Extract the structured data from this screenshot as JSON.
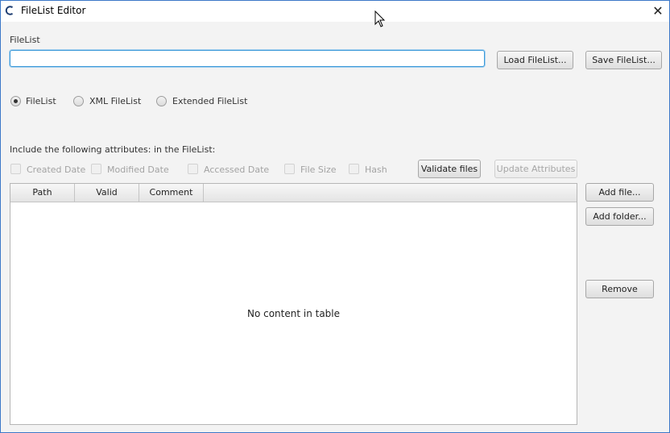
{
  "window": {
    "title": "FileList Editor"
  },
  "filelist": {
    "label": "FileList",
    "value": "",
    "load_button": "Load FileList...",
    "save_button": "Save FileList..."
  },
  "format": {
    "options": [
      "FileList",
      "XML FileList",
      "Extended FileList"
    ],
    "selected": "FileList"
  },
  "attributes": {
    "label": "Include the following attributes: in the FileList:",
    "options": [
      "Created Date",
      "Modified Date",
      "Accessed Date",
      "File Size",
      "Hash"
    ],
    "validate_button": "Validate files",
    "update_button": "Update Attributes"
  },
  "table": {
    "columns": [
      "Path",
      "Valid",
      "Comment"
    ],
    "empty_message": "No content in table"
  },
  "side_buttons": {
    "add_file": "Add file...",
    "add_folder": "Add folder...",
    "remove": "Remove"
  }
}
